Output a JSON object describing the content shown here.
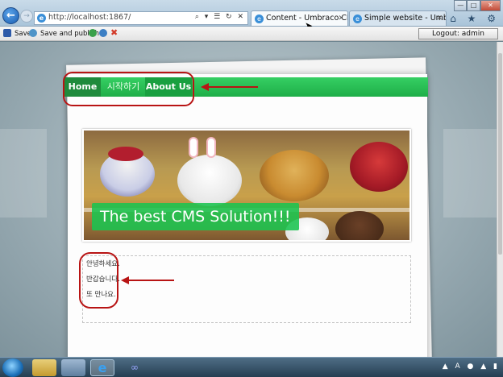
{
  "browser": {
    "url": "http://localhost:1867/",
    "tabs": [
      {
        "title": "Content - Umbraco CMS -..."
      },
      {
        "title": "Simple website - Umbraco..."
      }
    ],
    "address_icons": "⌕ ▾ ☰ ↻ ✕",
    "right_icons": "⌂ ★ ⚙"
  },
  "umbraco_toolbar": {
    "save_label": "Save",
    "save_publish_label": "Save and publish",
    "logout_label": "Logout: admin"
  },
  "site": {
    "nav": [
      {
        "label": "Home"
      },
      {
        "label": "시작하기"
      },
      {
        "label": "About Us"
      }
    ],
    "banner_caption": "The best CMS Solution!!!",
    "content_lines": [
      "안녕하세요.",
      "반갑습니다.",
      "또 만나요."
    ]
  },
  "colors": {
    "nav_green": "#1fae48",
    "nav_active": "#1f8a3c",
    "annotation_red": "#b81414"
  }
}
